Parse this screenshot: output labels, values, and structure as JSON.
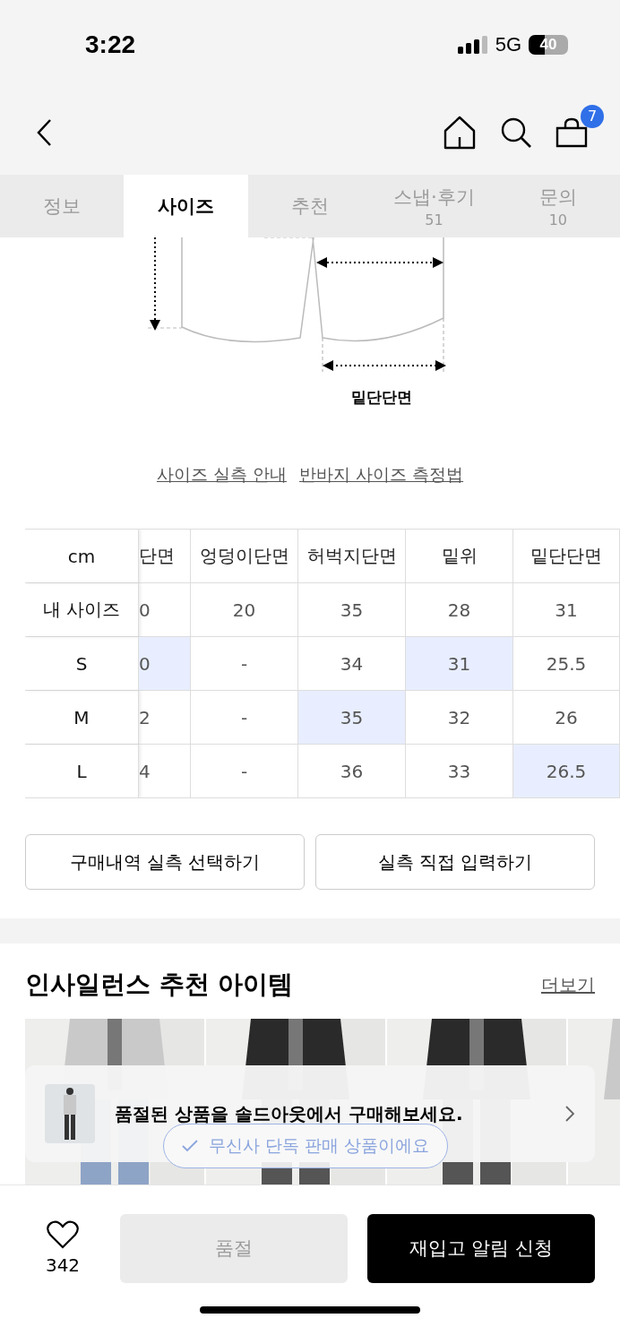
{
  "status_bar": {
    "time": "3:22",
    "network": "5G",
    "battery": "40"
  },
  "nav": {
    "cart_count": "7"
  },
  "tabs": [
    {
      "label": "정보",
      "selected": false
    },
    {
      "label": "사이즈",
      "selected": true
    },
    {
      "label": "추천",
      "selected": false
    },
    {
      "label": "스냅·후기",
      "count": "51",
      "selected": false
    },
    {
      "label": "문의",
      "count": "10",
      "selected": false
    }
  ],
  "diagram": {
    "label": "밑단단면"
  },
  "size_links": [
    "사이즈 실측 안내",
    "반바지 사이즈 측정법"
  ],
  "size_table": {
    "corner": "cm",
    "columns": [
      "단면",
      "엉덩이단면",
      "허벅지단면",
      "밑위",
      "밑단단면"
    ],
    "rows": [
      {
        "label": "내 사이즈",
        "cells": [
          {
            "text": "0",
            "highlighted": false
          },
          {
            "text": "20",
            "highlighted": false
          },
          {
            "text": "35",
            "highlighted": false
          },
          {
            "text": "28",
            "highlighted": false
          },
          {
            "text": "31",
            "highlighted": false
          }
        ]
      },
      {
        "label": "S",
        "cells": [
          {
            "text": "0",
            "highlighted": true
          },
          {
            "text": "-",
            "highlighted": false
          },
          {
            "text": "34",
            "highlighted": false
          },
          {
            "text": "31",
            "highlighted": true
          },
          {
            "text": "25.5",
            "highlighted": false
          }
        ]
      },
      {
        "label": "M",
        "cells": [
          {
            "text": "2",
            "highlighted": false
          },
          {
            "text": "-",
            "highlighted": false
          },
          {
            "text": "35",
            "highlighted": true
          },
          {
            "text": "32",
            "highlighted": false
          },
          {
            "text": "26",
            "highlighted": false
          }
        ]
      },
      {
        "label": "L",
        "cells": [
          {
            "text": "4",
            "highlighted": false
          },
          {
            "text": "-",
            "highlighted": false
          },
          {
            "text": "36",
            "highlighted": false
          },
          {
            "text": "33",
            "highlighted": false
          },
          {
            "text": "26.5",
            "highlighted": true
          }
        ]
      }
    ]
  },
  "size_buttons": [
    "구매내역 실측 선택하기",
    "실측 직접 입력하기"
  ],
  "recommend": {
    "title": "인사일런스 추천 아이템",
    "more": "더보기"
  },
  "soldout_banner": {
    "text": "품절된 상품을 솔드아웃에서 구매해보세요."
  },
  "exclusive_badge": "무신사 단독 판매 상품이에요",
  "bottom_bar": {
    "likes": "342",
    "buttons": [
      {
        "label": "품절",
        "disabled": true
      },
      {
        "label": "재입고 알림 신청",
        "disabled": false
      }
    ]
  }
}
